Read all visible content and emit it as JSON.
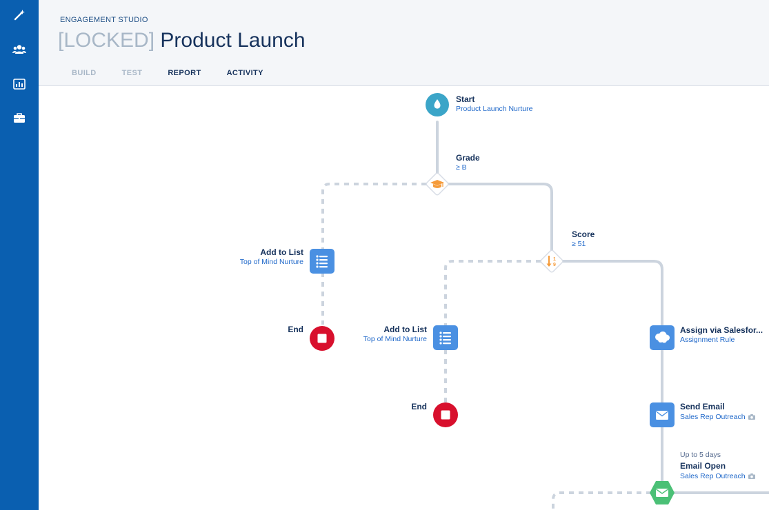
{
  "sidebar": {
    "items": [
      {
        "icon": "magic-wand-icon"
      },
      {
        "icon": "users-icon"
      },
      {
        "icon": "reports-chart-icon"
      },
      {
        "icon": "briefcase-icon"
      }
    ],
    "color": "#0a5fb0"
  },
  "header": {
    "eyebrow": "ENGAGEMENT STUDIO",
    "locked_prefix": "[LOCKED]",
    "title": "Product Launch",
    "tabs": [
      {
        "label": "BUILD",
        "state": "disabled"
      },
      {
        "label": "TEST",
        "state": "disabled"
      },
      {
        "label": "REPORT",
        "state": "enabled"
      },
      {
        "label": "ACTIVITY",
        "state": "enabled"
      }
    ]
  },
  "flow": {
    "start": {
      "title": "Start",
      "subtitle": "Product Launch Nurture",
      "icon": "water-drop-icon",
      "color": "#3ba5c8"
    },
    "grade": {
      "title": "Grade",
      "subtitle": "≥ B",
      "icon": "graduation-cap-icon",
      "color": "#f59b3a"
    },
    "score": {
      "title": "Score",
      "subtitle": "≥ 51",
      "icon": "sort-numbers-icon",
      "color": "#f59b3a"
    },
    "add_list_1": {
      "title": "Add to List",
      "subtitle": "Top of Mind Nurture",
      "icon": "list-icon"
    },
    "end_1": {
      "title": "End",
      "icon": "stop-icon",
      "color": "#d8102d"
    },
    "add_list_2": {
      "title": "Add to List",
      "subtitle": "Top of Mind Nurture",
      "icon": "list-icon"
    },
    "end_2": {
      "title": "End",
      "icon": "stop-icon",
      "color": "#d8102d"
    },
    "assign": {
      "title": "Assign via Salesfor...",
      "subtitle": "Assignment Rule",
      "icon": "salesforce-cloud-icon"
    },
    "send_email": {
      "title": "Send Email",
      "subtitle": "Sales Rep Outreach",
      "icon": "envelope-icon"
    },
    "email_open": {
      "wait": "Up to 5 days",
      "title": "Email Open",
      "subtitle": "Sales Rep Outreach",
      "icon": "envelope-icon",
      "color": "#4bc076"
    },
    "action_color": "#4a90e2",
    "connector_color": "#ccd4de"
  }
}
